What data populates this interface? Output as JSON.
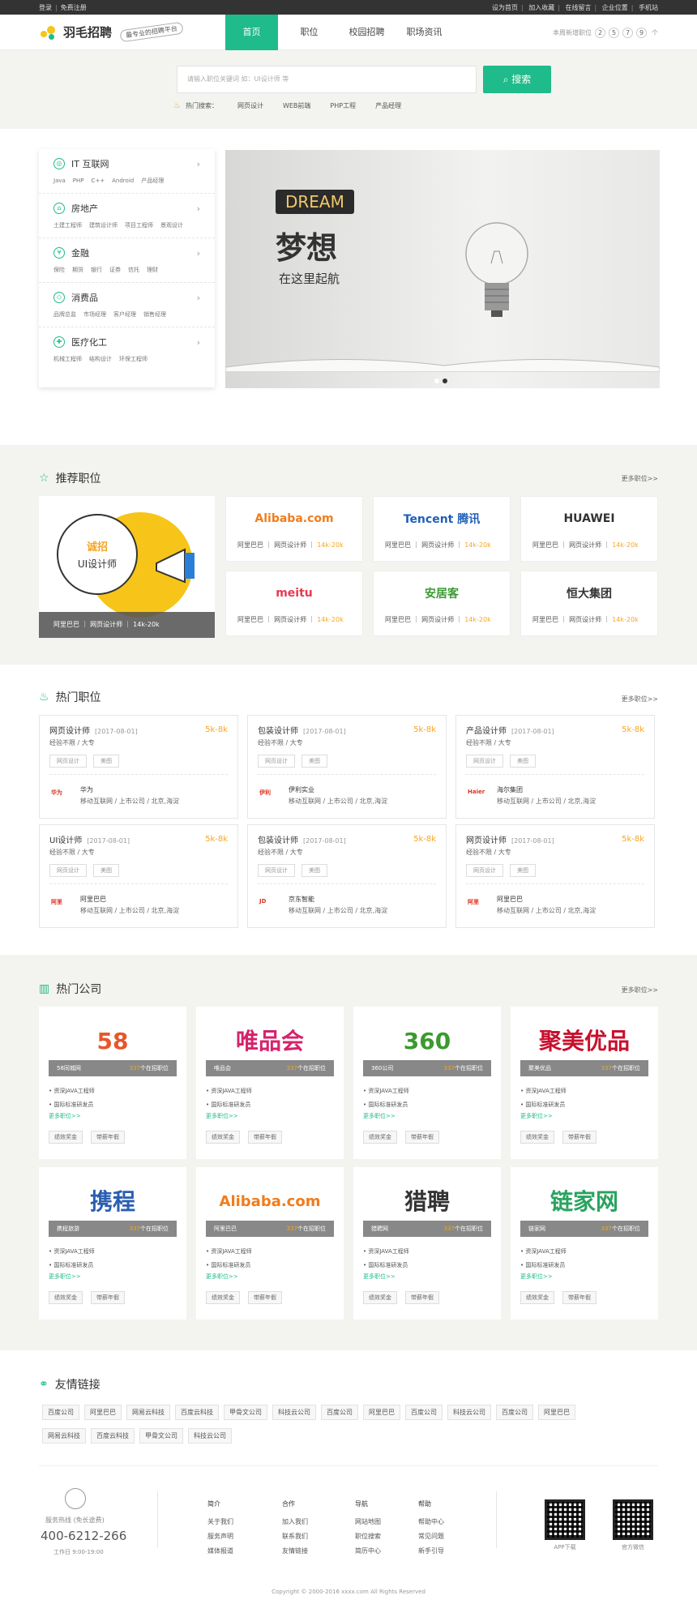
{
  "topbar": {
    "login": "登录",
    "register": "免费注册",
    "links": [
      "设为首页",
      "加入收藏",
      "在线留言",
      "企业位置",
      "手机站"
    ]
  },
  "brand": {
    "name": "羽毛招聘",
    "slogan": "最专业的招聘平台"
  },
  "nav": [
    {
      "label": "首页",
      "active": true
    },
    {
      "label": "职位"
    },
    {
      "label": "校园招聘"
    },
    {
      "label": "职场资讯"
    }
  ],
  "weekly": {
    "label": "本周新增职位",
    "digits": [
      "2",
      "5",
      "7",
      "9"
    ],
    "arrow": "个"
  },
  "search": {
    "placeholder": "请输入职位关键词 如：UI设计师 等",
    "button": "搜索",
    "hot_label": "热门搜索：",
    "hot": [
      "网页设计",
      "WEB前端",
      "PHP工程",
      "产品经理"
    ]
  },
  "categories": [
    {
      "title": "IT 互联网",
      "icon": "globe-icon",
      "subs": [
        "Java",
        "PHP",
        "C++",
        "Android",
        "产品经理"
      ]
    },
    {
      "title": "房地产",
      "icon": "house-icon",
      "subs": [
        "土建工程师",
        "建筑设计师",
        "项目工程师",
        "景观设计"
      ]
    },
    {
      "title": "金融",
      "icon": "yen-icon",
      "subs": [
        "保险",
        "期货",
        "银行",
        "证券",
        "信托",
        "理财"
      ]
    },
    {
      "title": "消费品",
      "icon": "tag-icon",
      "subs": [
        "品牌总监",
        "市场经理",
        "客户经理",
        "销售经理"
      ]
    },
    {
      "title": "医疗化工",
      "icon": "medical-icon",
      "subs": [
        "机械工程师",
        "结构设计",
        "环保工程师"
      ]
    }
  ],
  "banner": {
    "tag": "DREAM",
    "title": "梦想",
    "subtitle": "在这里起航"
  },
  "recommend": {
    "title": "推荐职位",
    "more": "更多职位>>",
    "featured": {
      "circle_title": "诚招",
      "circle_sub": "UI设计师",
      "caption": "阿里巴巴 ｜ 网页设计师 ｜ 14k-20k"
    },
    "cards": [
      {
        "logo": "Alibaba.com",
        "company": "阿里巴巴",
        "job": "网页设计师",
        "salary": "14k-20k",
        "color": "#f07c1c"
      },
      {
        "logo": "Tencent 腾讯",
        "company": "阿里巴巴",
        "job": "网页设计师",
        "salary": "14k-20k",
        "color": "#1f5fb8"
      },
      {
        "logo": "HUAWEI",
        "company": "阿里巴巴",
        "job": "网页设计师",
        "salary": "14k-20k",
        "color": "#333333"
      },
      {
        "logo": "meitu",
        "company": "阿里巴巴",
        "job": "网页设计师",
        "salary": "14k-20k",
        "color": "#e8384f"
      },
      {
        "logo": "安居客",
        "company": "阿里巴巴",
        "job": "网页设计师",
        "salary": "14k-20k",
        "color": "#3a9a2e"
      },
      {
        "logo": "恒大集团",
        "company": "阿里巴巴",
        "job": "网页设计师",
        "salary": "14k-20k",
        "color": "#333333"
      }
    ]
  },
  "hotjobs": {
    "title": "热门职位",
    "more": "更多职位>>",
    "jobs": [
      {
        "title": "网页设计师",
        "date": "[2017-08-01]",
        "salary": "5k-8k",
        "req": "经验不限 / 大专",
        "tags": [
          "网页设计",
          "美图"
        ],
        "logo": "华为",
        "company": "华为",
        "meta": "移动互联网 / 上市公司 / 北京,海淀"
      },
      {
        "title": "包装设计师",
        "date": "[2017-08-01]",
        "salary": "5k-8k",
        "req": "经验不限 / 大专",
        "tags": [
          "网页设计",
          "美图"
        ],
        "logo": "伊利",
        "company": "伊利实业",
        "meta": "移动互联网 / 上市公司 / 北京,海淀"
      },
      {
        "title": "产品设计师",
        "date": "[2017-08-01]",
        "salary": "5k-8k",
        "req": "经验不限 / 大专",
        "tags": [
          "网页设计",
          "美图"
        ],
        "logo": "Haier",
        "company": "海尔集团",
        "meta": "移动互联网 / 上市公司 / 北京,海淀"
      },
      {
        "title": "UI设计师",
        "date": "[2017-08-01]",
        "salary": "5k-8k",
        "req": "经验不限 / 大专",
        "tags": [
          "网页设计",
          "美图"
        ],
        "logo": "阿里",
        "company": "阿里巴巴",
        "meta": "移动互联网 / 上市公司 / 北京,海淀"
      },
      {
        "title": "包装设计师",
        "date": "[2017-08-01]",
        "salary": "5k-8k",
        "req": "经验不限 / 大专",
        "tags": [
          "网页设计",
          "美图"
        ],
        "logo": "JD",
        "company": "京东智能",
        "meta": "移动互联网 / 上市公司 / 北京,海淀"
      },
      {
        "title": "网页设计师",
        "date": "[2017-08-01]",
        "salary": "5k-8k",
        "req": "经验不限 / 大专",
        "tags": [
          "网页设计",
          "美图"
        ],
        "logo": "阿里",
        "company": "阿里巴巴",
        "meta": "移动互联网 / 上市公司 / 北京,海淀"
      }
    ]
  },
  "companies": {
    "title": "热门公司",
    "more": "更多职位>>",
    "unit": "个在招职位",
    "list_items": [
      "资深JAVA工程师",
      "国际标准研发员"
    ],
    "list_more": "更多职位>>",
    "tags": [
      "绩效奖金",
      "带薪年假"
    ],
    "items": [
      {
        "logo": "58",
        "name": "58同城网",
        "count": "337",
        "color": "#e8552b"
      },
      {
        "logo": "唯品会",
        "name": "唯品会",
        "count": "337",
        "color": "#d6226b"
      },
      {
        "logo": "360",
        "name": "360公司",
        "count": "337",
        "color": "#3a9a2e"
      },
      {
        "logo": "聚美优品",
        "name": "聚美优品",
        "count": "337",
        "color": "#c8102e"
      },
      {
        "logo": "携程",
        "name": "携程旅游",
        "count": "337",
        "color": "#2a5fb0"
      },
      {
        "logo": "Alibaba.com",
        "name": "阿里巴巴",
        "count": "337",
        "color": "#f07c1c"
      },
      {
        "logo": "猎聘",
        "name": "猎聘网",
        "count": "337",
        "color": "#333333"
      },
      {
        "logo": "链家网",
        "name": "链家网",
        "count": "337",
        "color": "#2aa35f"
      }
    ]
  },
  "friends": {
    "title": "友情链接",
    "links": [
      "百度公司",
      "阿里巴巴",
      "网易云科技",
      "百度云科技",
      "甲骨文公司",
      "科技云公司",
      "百度公司",
      "阿里巴巴",
      "百度公司",
      "科技云公司",
      "百度公司",
      "阿里巴巴",
      "网易云科技",
      "百度云科技",
      "甲骨文公司",
      "科技云公司"
    ]
  },
  "footer": {
    "hotline_label": "服务热线 (免长途费)",
    "hotline": "400-6212-266",
    "worktime": "工作日 9:00-19:00",
    "cols": [
      {
        "title": "简介",
        "items": [
          "关于我们",
          "服务声明",
          "媒体报道"
        ]
      },
      {
        "title": "合作",
        "items": [
          "加入我们",
          "联系我们",
          "友情链接"
        ]
      },
      {
        "title": "导航",
        "items": [
          "网站地图",
          "职位搜索",
          "简历中心"
        ]
      },
      {
        "title": "帮助",
        "items": [
          "帮助中心",
          "常见问题",
          "新手引导"
        ]
      }
    ],
    "qr": [
      "APP下载",
      "官方微信"
    ],
    "copyright": "Copyright © 2000-2016 xxxx.com All Rights Reserved"
  },
  "colors": {
    "accent": "#1fbb8a",
    "salary": "#f5a623",
    "grey_band": "#f3f4f0"
  }
}
